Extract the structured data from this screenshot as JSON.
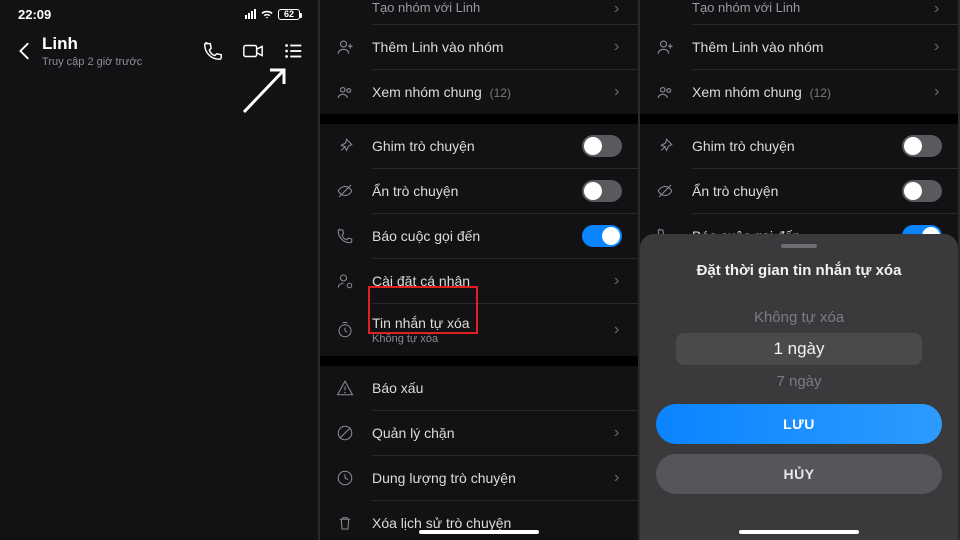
{
  "panel1": {
    "status": {
      "time": "22:09",
      "battery": "62"
    },
    "contact": {
      "name": "Linh",
      "activity": "Truy cập 2 giờ trước"
    }
  },
  "panel2": {
    "items": {
      "group_create": "Tạo nhóm với Linh",
      "group_add": "Thêm Linh vào nhóm",
      "group_mutual": "Xem nhóm chung",
      "group_mutual_count": "(12)",
      "pin": "Ghim trò chuyện",
      "hide": "Ẩn trò chuyện",
      "call_notify": "Báo cuộc gọi đến",
      "personal": "Cài đặt cá nhân",
      "auto_delete": "Tin nhắn tự xóa",
      "auto_delete_sub": "Không tự xóa",
      "report": "Báo xấu",
      "block": "Quản lý chặn",
      "storage": "Dung lượng trò chuyện",
      "clear": "Xóa lịch sử trò chuyện"
    },
    "toggles": {
      "pin": false,
      "hide": false,
      "call_notify": true
    }
  },
  "panel3": {
    "items": {
      "group_create": "Tạo nhóm với Linh",
      "group_add": "Thêm Linh vào nhóm",
      "group_mutual": "Xem nhóm chung",
      "group_mutual_count": "(12)",
      "pin": "Ghim trò chuyện",
      "hide": "Ẩn trò chuyện",
      "call_notify": "Báo cuộc gọi đến"
    },
    "toggles": {
      "pin": false,
      "hide": false,
      "call_notify": true
    },
    "sheet": {
      "title": "Đặt thời gian tin nhắn tự xóa",
      "options": {
        "opt0": "Không tự xóa",
        "opt1": "1 ngày",
        "opt2": "7 ngày"
      },
      "save": "LƯU",
      "cancel": "HỦY"
    }
  }
}
